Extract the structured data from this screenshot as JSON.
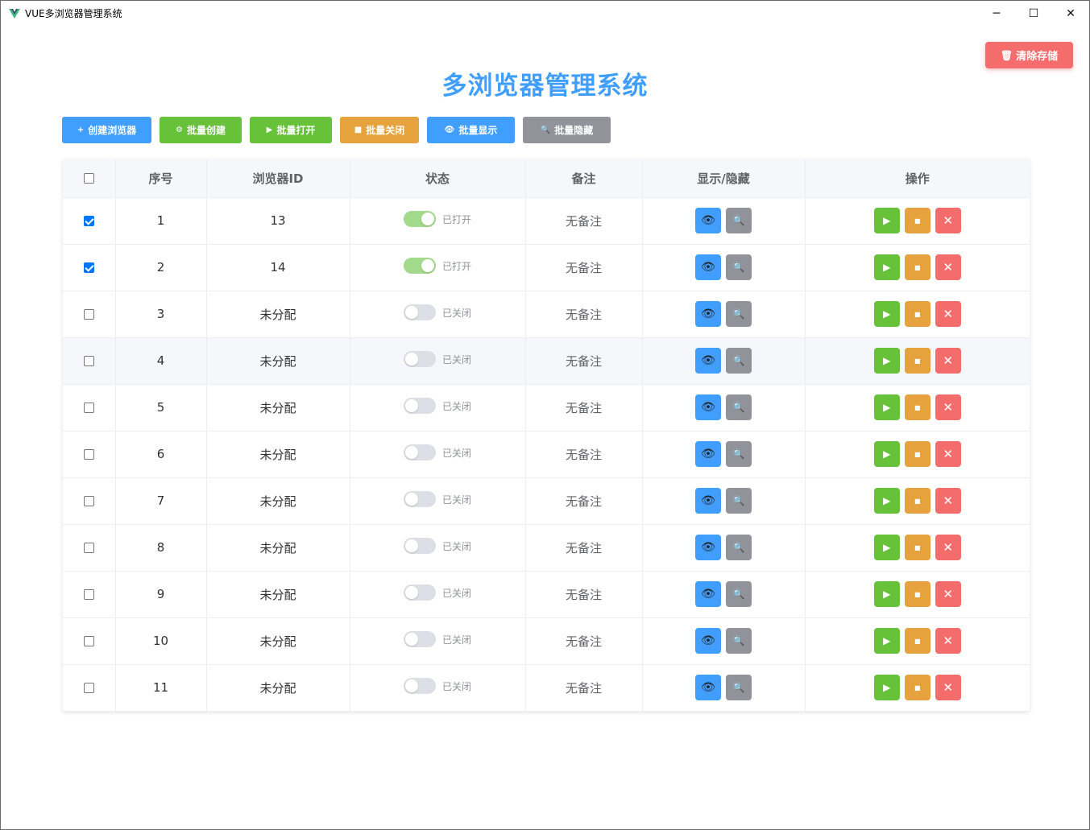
{
  "window": {
    "title": "VUE多浏览器管理系统",
    "controls": [
      "─",
      "☐",
      "✕"
    ]
  },
  "clear_button": {
    "label": "清除存储",
    "icon": "trash-icon"
  },
  "page_title": "多浏览器管理系统",
  "toolbar": [
    {
      "label": "创建浏览器",
      "icon": "plus-icon",
      "glyph": "+",
      "color": "#409eff",
      "width": 111
    },
    {
      "label": "批量创建",
      "icon": "gear-icon",
      "glyph": "⚙",
      "color": "#67c23a",
      "width": 102
    },
    {
      "label": "批量打开",
      "icon": "play-icon",
      "glyph": "▶",
      "color": "#67c23a",
      "width": 102
    },
    {
      "label": "批量关闭",
      "icon": "stop-icon",
      "glyph": "■",
      "color": "#e6a23c",
      "width": 98
    },
    {
      "label": "批量显示",
      "icon": "eye-icon",
      "glyph": "👁",
      "color": "#409eff",
      "width": 109
    },
    {
      "label": "批量隐藏",
      "icon": "magnifier-icon",
      "glyph": "🔍",
      "color": "#909399",
      "width": 109
    }
  ],
  "table": {
    "headers": [
      "序号",
      "浏览器ID",
      "状态",
      "备注",
      "显示/隐藏",
      "操作"
    ],
    "rows": [
      {
        "checked": true,
        "index": "1",
        "browser_id": "13",
        "on": true,
        "status": "已打开",
        "remark": "无备注"
      },
      {
        "checked": true,
        "index": "2",
        "browser_id": "14",
        "on": true,
        "status": "已打开",
        "remark": "无备注"
      },
      {
        "checked": false,
        "index": "3",
        "browser_id": "未分配",
        "on": false,
        "status": "已关闭",
        "remark": "无备注"
      },
      {
        "checked": false,
        "index": "4",
        "browser_id": "未分配",
        "on": false,
        "status": "已关闭",
        "remark": "无备注"
      },
      {
        "checked": false,
        "index": "5",
        "browser_id": "未分配",
        "on": false,
        "status": "已关闭",
        "remark": "无备注"
      },
      {
        "checked": false,
        "index": "6",
        "browser_id": "未分配",
        "on": false,
        "status": "已关闭",
        "remark": "无备注"
      },
      {
        "checked": false,
        "index": "7",
        "browser_id": "未分配",
        "on": false,
        "status": "已关闭",
        "remark": "无备注"
      },
      {
        "checked": false,
        "index": "8",
        "browser_id": "未分配",
        "on": false,
        "status": "已关闭",
        "remark": "无备注"
      },
      {
        "checked": false,
        "index": "9",
        "browser_id": "未分配",
        "on": false,
        "status": "已关闭",
        "remark": "无备注"
      },
      {
        "checked": false,
        "index": "10",
        "browser_id": "未分配",
        "on": false,
        "status": "已关闭",
        "remark": "无备注"
      },
      {
        "checked": false,
        "index": "11",
        "browser_id": "未分配",
        "on": false,
        "status": "已关闭",
        "remark": "无备注"
      }
    ],
    "highlighted_row": 3
  },
  "icons": {
    "show": "eye-icon",
    "hide": "magnifier-icon",
    "open": "play-icon",
    "close": "stop-icon",
    "delete": "close-icon"
  },
  "colors": {
    "primary": "#409eff",
    "success": "#67c23a",
    "warning": "#e6a23c",
    "danger": "#f56c6c",
    "info": "#909399"
  }
}
